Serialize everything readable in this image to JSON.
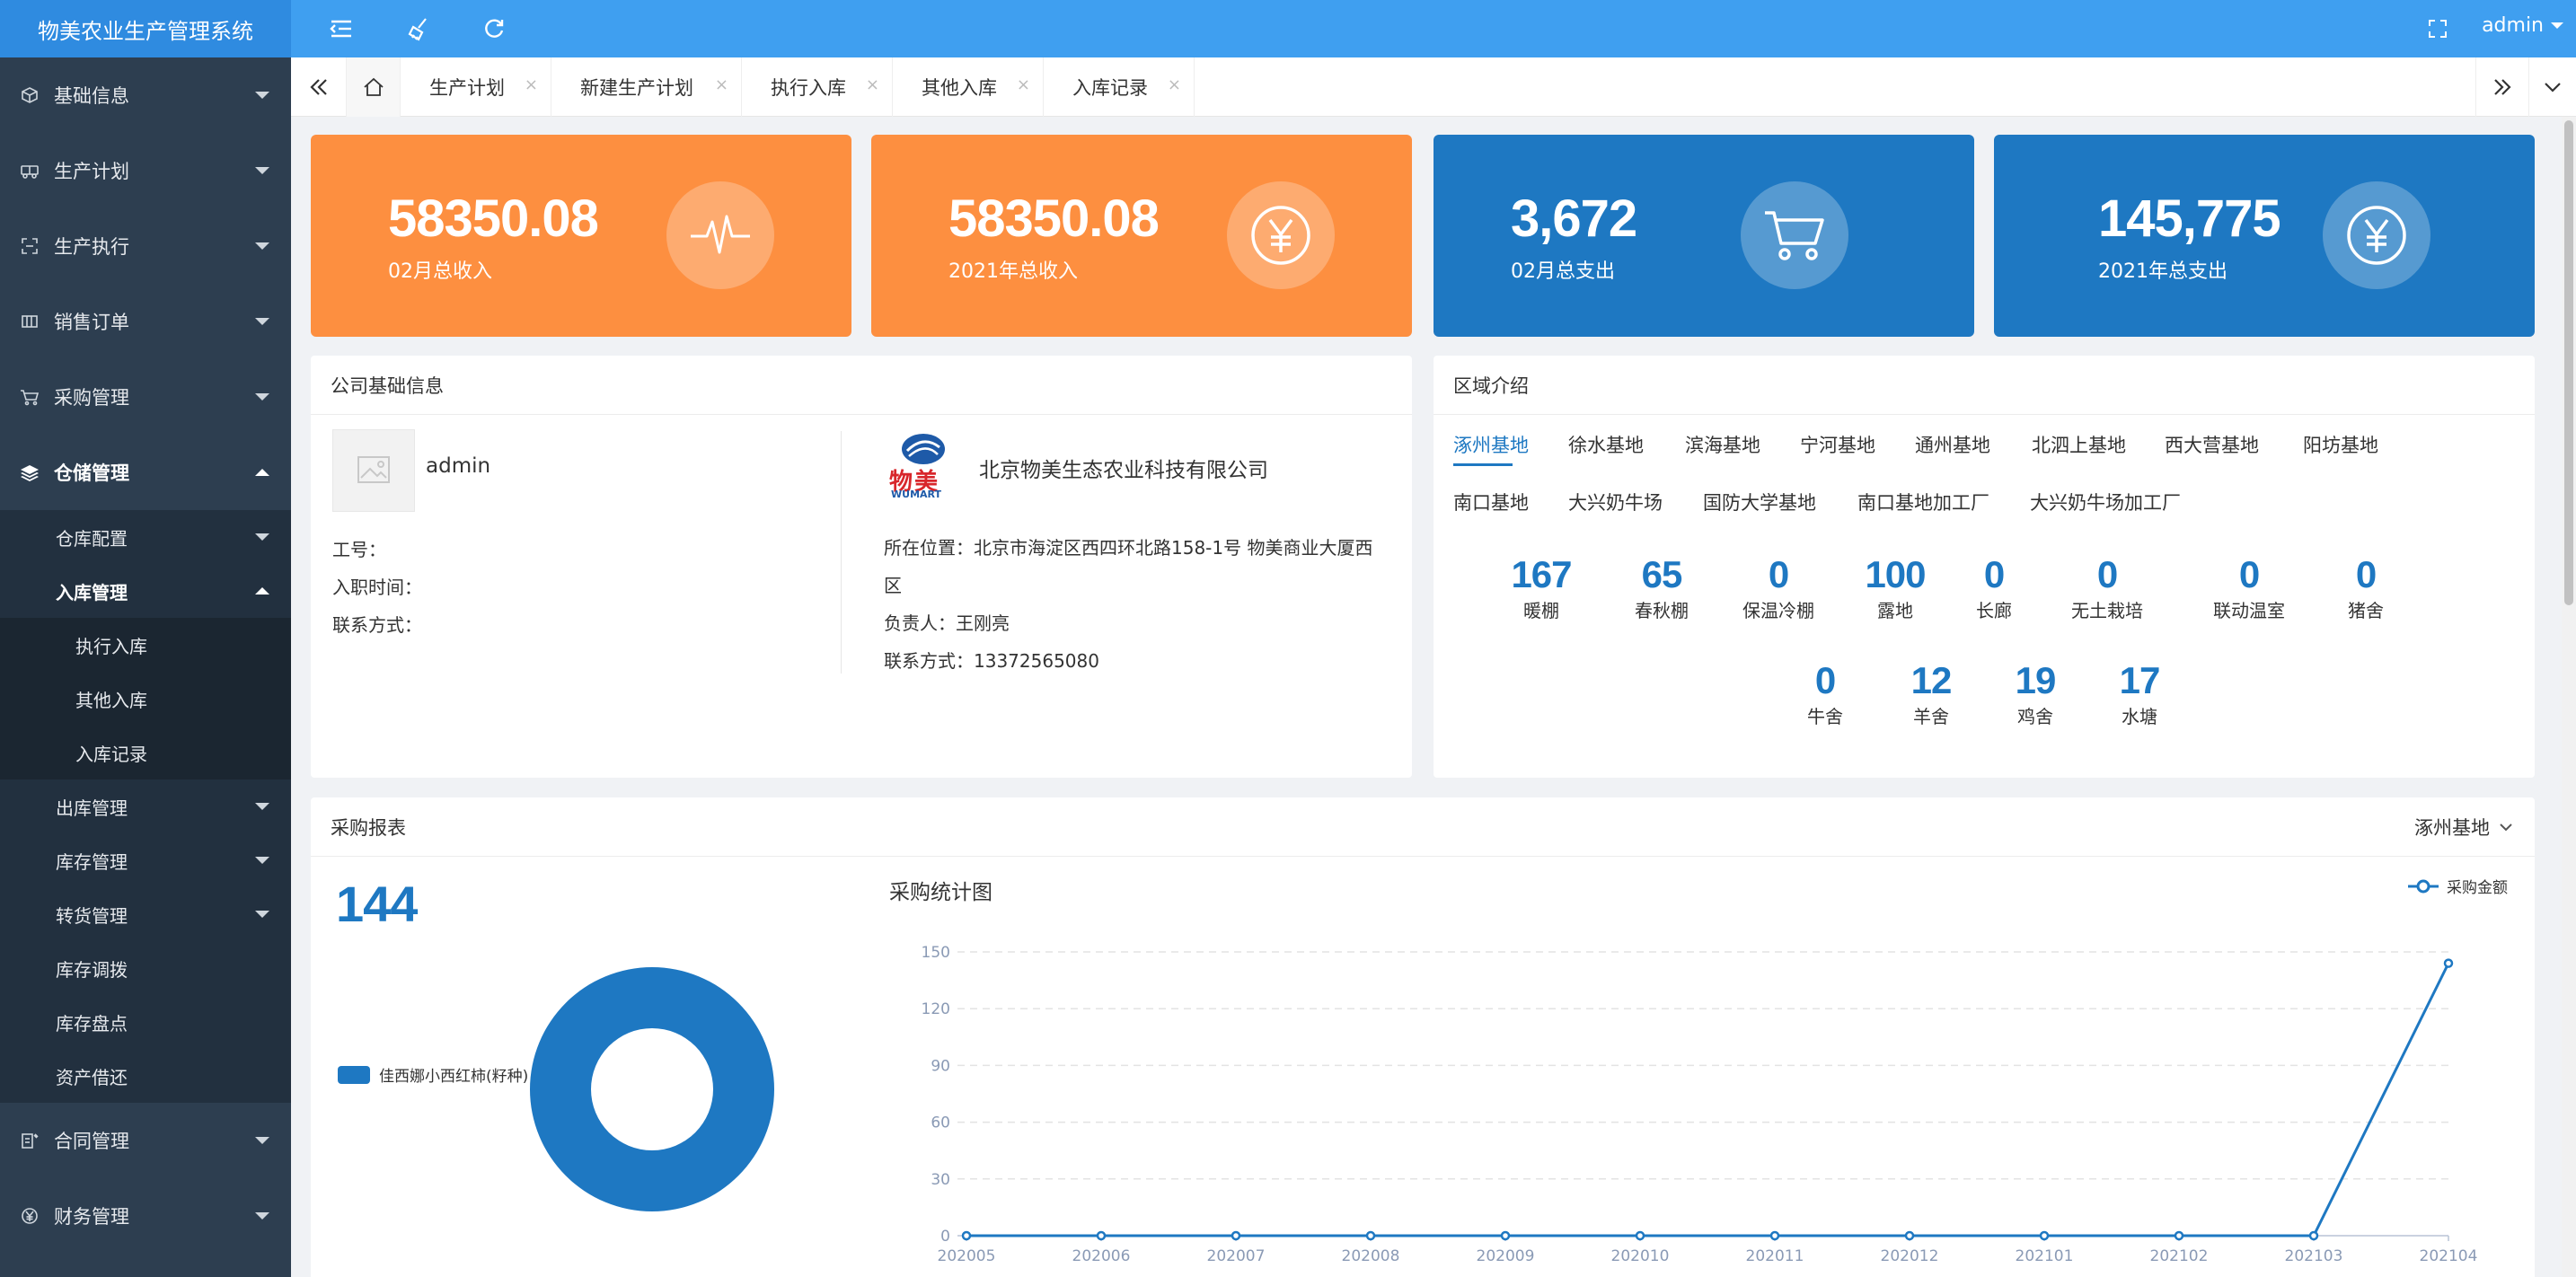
{
  "app": {
    "title": "物美农业生产管理系统",
    "user": "admin"
  },
  "sidebar": {
    "items": [
      {
        "label": "基础信息",
        "icon": "cube-icon"
      },
      {
        "label": "生产计划",
        "icon": "truck-icon"
      },
      {
        "label": "生产执行",
        "icon": "scan-icon"
      },
      {
        "label": "销售订单",
        "icon": "table-icon"
      },
      {
        "label": "采购管理",
        "icon": "cart-icon"
      },
      {
        "label": "仓储管理",
        "icon": "layers-icon"
      }
    ],
    "storage_sub": [
      {
        "label": "仓库配置"
      },
      {
        "label": "入库管理"
      }
    ],
    "inbound_sub": [
      {
        "label": "执行入库"
      },
      {
        "label": "其他入库"
      },
      {
        "label": "入库记录"
      }
    ],
    "storage_sub2": [
      {
        "label": "出库管理"
      },
      {
        "label": "库存管理"
      },
      {
        "label": "转货管理"
      },
      {
        "label": "库存调拨"
      },
      {
        "label": "库存盘点"
      },
      {
        "label": "资产借还"
      }
    ],
    "bottom_items": [
      {
        "label": "合同管理",
        "icon": "contract-icon"
      },
      {
        "label": "财务管理",
        "icon": "yen-icon"
      }
    ]
  },
  "tabs": [
    {
      "label": "生产计划"
    },
    {
      "label": "新建生产计划"
    },
    {
      "label": "执行入库"
    },
    {
      "label": "其他入库"
    },
    {
      "label": "入库记录"
    }
  ],
  "stats": [
    {
      "value": "58350.08",
      "label": "02月总收入",
      "icon": "pulse-icon",
      "color": "#fd8f40"
    },
    {
      "value": "58350.08",
      "label": "2021年总收入",
      "icon": "yen-icon",
      "color": "#fd8f40"
    },
    {
      "value": "3,672",
      "label": "02月总支出",
      "icon": "cart-icon",
      "color": "#1e78c2"
    },
    {
      "value": "145,775",
      "label": "2021年总支出",
      "icon": "yen-icon",
      "color": "#1e78c2"
    }
  ],
  "company": {
    "title": "公司基础信息",
    "username": "admin",
    "employee_no_label": "工号：",
    "join_date_label": "入职时间：",
    "contact_label": "联系方式：",
    "logo_text": "物美",
    "logo_sub": "WUMART",
    "name": "北京物美生态农业科技有限公司",
    "location_line1": "所在位置：北京市海淀区西四环北路158-1号 物美商业大厦西",
    "location_line2": "区",
    "manager": "负责人：王刚亮",
    "phone": "联系方式：13372565080"
  },
  "region": {
    "title": "区域介绍",
    "tabs_row1": [
      "涿州基地",
      "徐水基地",
      "滨海基地",
      "宁河基地",
      "通州基地",
      "北泗上基地",
      "西大营基地",
      "阳坊基地"
    ],
    "tabs_row2": [
      "南口基地",
      "大兴奶牛场",
      "国防大学基地",
      "南口基地加工厂",
      "大兴奶牛场加工厂"
    ],
    "stats_row1": [
      {
        "value": "167",
        "label": "暖棚"
      },
      {
        "value": "65",
        "label": "春秋棚"
      },
      {
        "value": "0",
        "label": "保温冷棚"
      },
      {
        "value": "100",
        "label": "露地"
      },
      {
        "value": "0",
        "label": "长廊"
      },
      {
        "value": "0",
        "label": "无土栽培"
      },
      {
        "value": "0",
        "label": "联动温室"
      },
      {
        "value": "0",
        "label": "猪舍"
      }
    ],
    "stats_row2": [
      {
        "value": "0",
        "label": "牛舍"
      },
      {
        "value": "12",
        "label": "羊舍"
      },
      {
        "value": "19",
        "label": "鸡舍"
      },
      {
        "value": "17",
        "label": "水塘"
      }
    ]
  },
  "purchase": {
    "title": "采购报表",
    "selector": "涿州基地",
    "total": "144",
    "pie_legend": "佳西娜小西红柿(籽种)",
    "line_title": "采购统计图",
    "line_legend": "采购金额"
  },
  "chart_data": [
    {
      "type": "pie",
      "labels": [
        "佳西娜小西红柿(籽种)"
      ],
      "values": [
        144
      ],
      "colors": [
        "#1e78c2"
      ]
    },
    {
      "type": "line",
      "title": "采购统计图",
      "categories": [
        "202005",
        "202006",
        "202007",
        "202008",
        "202009",
        "202010",
        "202011",
        "202012",
        "202101",
        "202102",
        "202103",
        "202104"
      ],
      "series": [
        {
          "name": "采购金额",
          "values": [
            0,
            0,
            0,
            0,
            0,
            0,
            0,
            0,
            0,
            0,
            0,
            144
          ]
        }
      ],
      "yticks": [
        0,
        30,
        60,
        90,
        120,
        150
      ],
      "ylim": [
        0,
        150
      ],
      "legend": "top-right",
      "grid": true
    }
  ]
}
